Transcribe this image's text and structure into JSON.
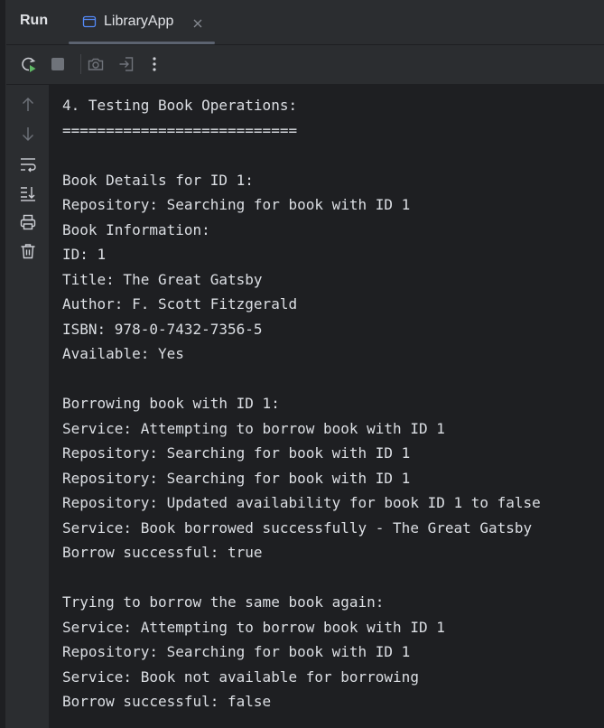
{
  "header": {
    "run_label": "Run",
    "tab": {
      "label": "LibraryApp",
      "icon": "window-icon",
      "close_icon": "close-icon"
    }
  },
  "toolbar": {
    "buttons": [
      {
        "name": "rerun-icon"
      },
      {
        "name": "stop-icon"
      },
      {
        "name": "screenshot-icon"
      },
      {
        "name": "exit-icon"
      },
      {
        "name": "more-options-icon"
      }
    ]
  },
  "gutter": {
    "buttons": [
      {
        "name": "arrow-up-icon"
      },
      {
        "name": "arrow-down-icon"
      },
      {
        "name": "soft-wrap-icon"
      },
      {
        "name": "scroll-to-end-icon"
      },
      {
        "name": "print-icon"
      },
      {
        "name": "trash-icon"
      }
    ]
  },
  "console": {
    "lines": [
      "4. Testing Book Operations:",
      "===========================",
      "",
      "Book Details for ID 1:",
      "Repository: Searching for book with ID 1",
      "Book Information:",
      "ID: 1",
      "Title: The Great Gatsby",
      "Author: F. Scott Fitzgerald",
      "ISBN: 978-0-7432-7356-5",
      "Available: Yes",
      "",
      "Borrowing book with ID 1:",
      "Service: Attempting to borrow book with ID 1",
      "Repository: Searching for book with ID 1",
      "Repository: Searching for book with ID 1",
      "Repository: Updated availability for book ID 1 to false",
      "Service: Book borrowed successfully - The Great Gatsby",
      "Borrow successful: true",
      "",
      "Trying to borrow the same book again:",
      "Service: Attempting to borrow book with ID 1",
      "Repository: Searching for book with ID 1",
      "Service: Book not available for borrowing",
      "Borrow successful: false"
    ]
  },
  "colors": {
    "panel_bg": "#2b2d30",
    "console_bg": "#1e1f22",
    "text": "#dcdfe4",
    "icon": "#ced0d6",
    "icon_disabled": "#6f737a",
    "rerun_accent": "#5fb865"
  }
}
